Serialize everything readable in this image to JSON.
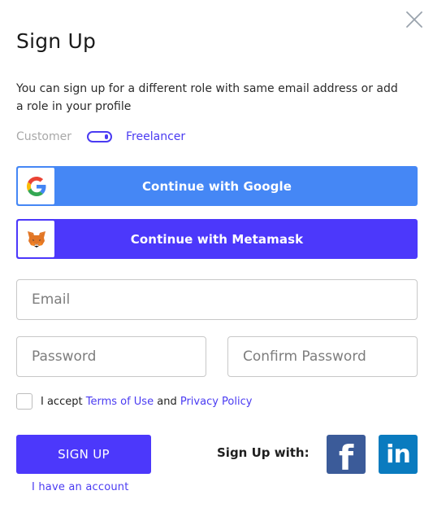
{
  "dialog": {
    "title": "Sign Up",
    "subtitle": "You can sign up for a different role with same email address or add a role in your profile",
    "close_icon": "close-icon"
  },
  "role_switch": {
    "left_label": "Customer",
    "right_label": "Freelancer",
    "selected": "Freelancer",
    "active_color": "#4a3bf2",
    "inactive_color": "#a8a8a8"
  },
  "oauth": {
    "google": {
      "label": "Continue with Google",
      "icon": "google-icon",
      "color": "#4587f5"
    },
    "metamask": {
      "label": "Continue with Metamask",
      "icon": "metamask-fox-icon",
      "color": "#4c38fb"
    }
  },
  "form": {
    "email": {
      "placeholder": "Email",
      "value": ""
    },
    "password": {
      "placeholder": "Password",
      "value": ""
    },
    "confirm_password": {
      "placeholder": "Confirm Password",
      "value": ""
    },
    "terms": {
      "checked": false,
      "prefix": "I accept",
      "terms_link": "Terms of Use",
      "and": "and",
      "privacy_link": "Privacy Policy"
    }
  },
  "actions": {
    "signup_button": "SIGN UP",
    "have_account_link": "I have an account",
    "signup_with_label": "Sign Up with:"
  },
  "social": {
    "facebook": {
      "glyph": "f",
      "icon": "facebook-icon",
      "color": "#3b5b99"
    },
    "linkedin": {
      "glyph": "in",
      "icon": "linkedin-icon",
      "color": "#0a7bbf"
    }
  },
  "colors": {
    "accent": "#4c38fb",
    "link": "#4a3bf2",
    "google_blue": "#4587f5"
  }
}
